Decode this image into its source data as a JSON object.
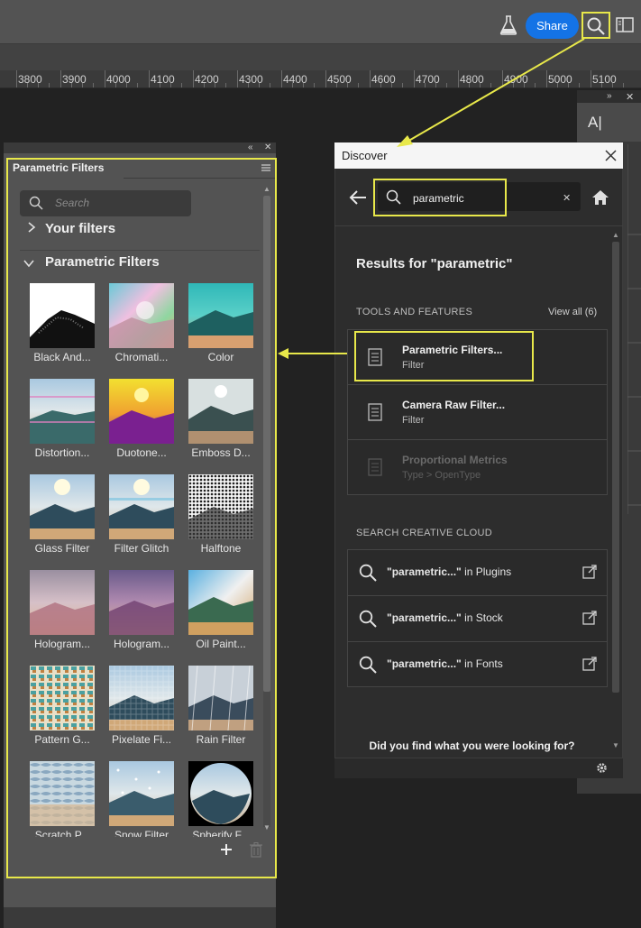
{
  "topbar": {
    "share_label": "Share",
    "icons": [
      "flask-icon",
      "search-icon",
      "panels-icon"
    ]
  },
  "ruler": {
    "labels": [
      "3800",
      "3900",
      "4000",
      "4100",
      "4200",
      "4300",
      "4400",
      "4500",
      "4600",
      "4700",
      "4800",
      "4900",
      "5000",
      "5100"
    ]
  },
  "right_strip": {
    "tool_label": "A|"
  },
  "left_panel": {
    "tab_title": "Parametric Filters",
    "search_placeholder": "Search",
    "your_filters": "Your filters",
    "section_title": "Parametric Filters",
    "filters": [
      {
        "label": "Black And..."
      },
      {
        "label": "Chromati..."
      },
      {
        "label": "Color"
      },
      {
        "label": "Distortion..."
      },
      {
        "label": "Duotone..."
      },
      {
        "label": "Emboss D..."
      },
      {
        "label": "Glass Filter"
      },
      {
        "label": "Filter Glitch"
      },
      {
        "label": "Halftone"
      },
      {
        "label": "Hologram..."
      },
      {
        "label": "Hologram..."
      },
      {
        "label": "Oil Paint..."
      },
      {
        "label": "Pattern G..."
      },
      {
        "label": "Pixelate Fi..."
      },
      {
        "label": "Rain Filter"
      },
      {
        "label": "Scratch P..."
      },
      {
        "label": "Snow Filter"
      },
      {
        "label": "Spherify F..."
      }
    ]
  },
  "discover": {
    "title": "Discover",
    "search_value": "parametric",
    "results_heading": "Results for \"parametric\"",
    "tools_heading": "TOOLS AND FEATURES",
    "view_all": "View all (6)",
    "tools": [
      {
        "title": "Parametric Filters...",
        "sub": "Filter"
      },
      {
        "title": "Camera Raw Filter...",
        "sub": "Filter"
      },
      {
        "title": "Proportional Metrics",
        "sub": "Type > OpenType"
      }
    ],
    "cc_heading": "SEARCH CREATIVE CLOUD",
    "cc_items": [
      {
        "bold": "\"parametric...\"",
        "rest": " in Plugins"
      },
      {
        "bold": "\"parametric...\"",
        "rest": " in Stock"
      },
      {
        "bold": "\"parametric...\"",
        "rest": " in Fonts"
      }
    ],
    "footer_question": "Did you find what you were looking for?"
  },
  "colors": {
    "highlight": "#e8e84a",
    "share_blue": "#1473e6"
  }
}
